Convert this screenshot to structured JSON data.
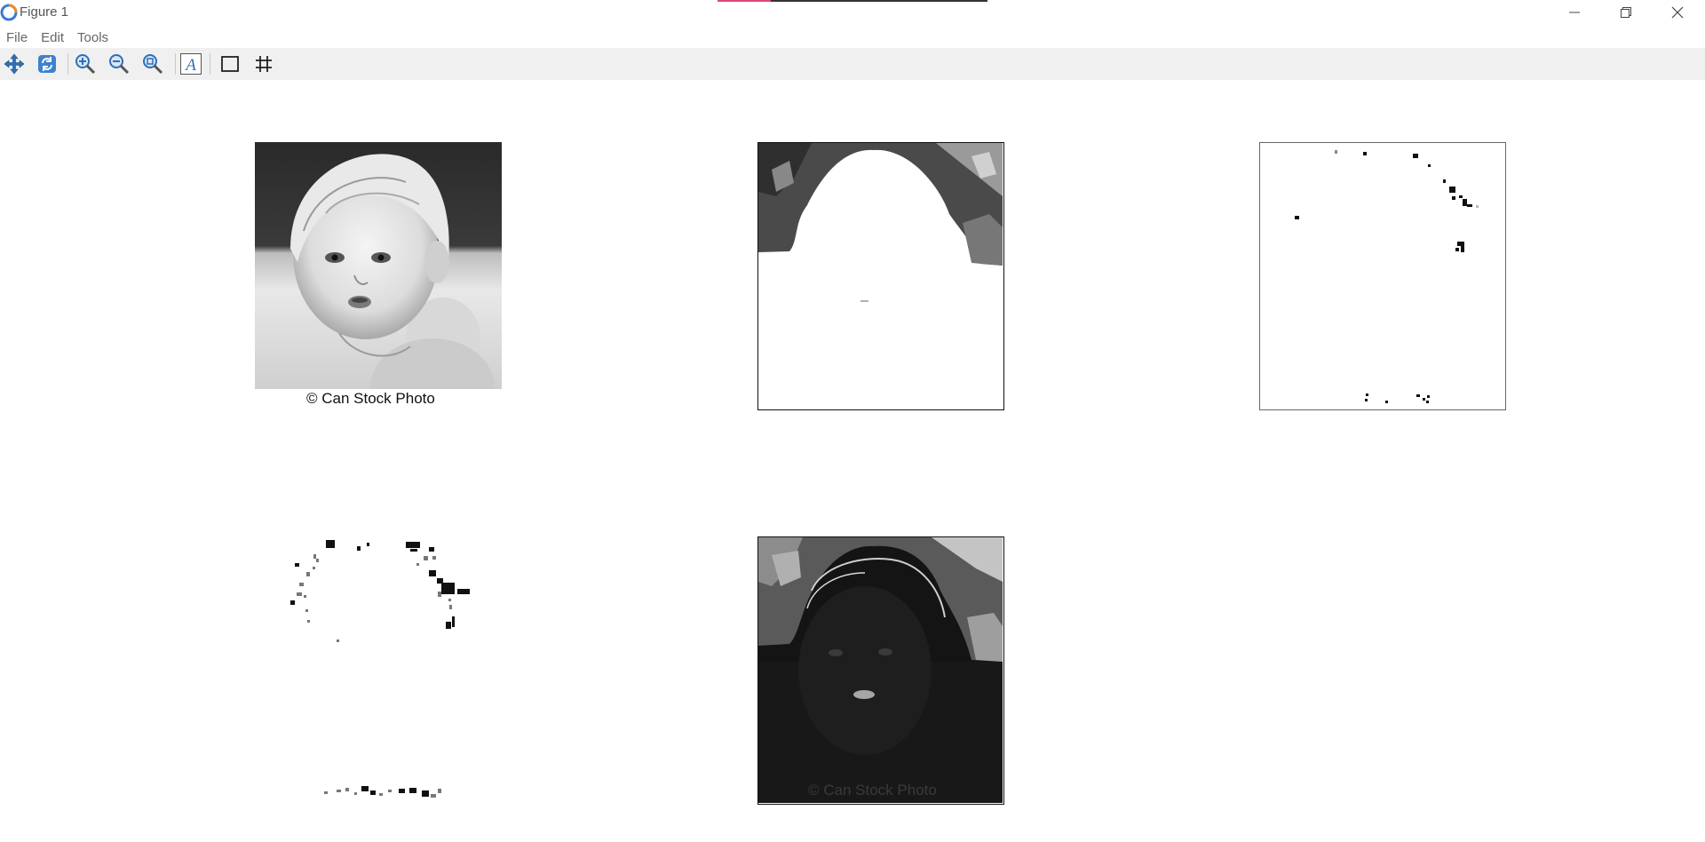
{
  "window": {
    "title": "Figure 1",
    "controls": [
      "minimize",
      "maximize",
      "close"
    ]
  },
  "menubar": {
    "items": [
      {
        "label": "File"
      },
      {
        "label": "Edit"
      },
      {
        "label": "Tools"
      }
    ]
  },
  "toolbar": {
    "buttons": [
      {
        "icon": "pan-arrows-icon"
      },
      {
        "icon": "refresh-icon"
      },
      {
        "icon": "zoom-in-icon"
      },
      {
        "icon": "zoom-out-icon"
      },
      {
        "icon": "zoom-fit-icon"
      },
      {
        "icon": "text-A-icon"
      },
      {
        "icon": "box-icon"
      },
      {
        "icon": "grid-icon"
      }
    ]
  },
  "figure": {
    "panels": [
      {
        "name": "original-photo",
        "caption": "© Can Stock Photo"
      },
      {
        "name": "threshold-mask"
      },
      {
        "name": "sparse-mask"
      },
      {
        "name": "speckle-map"
      },
      {
        "name": "dark-edge-image",
        "watermark": "© Can Stock Photo"
      }
    ]
  },
  "colors": {
    "toolbar_bg": "#f0f0f0",
    "accent_pink": "#e0457b",
    "icon_blue": "#2f6fb5"
  }
}
